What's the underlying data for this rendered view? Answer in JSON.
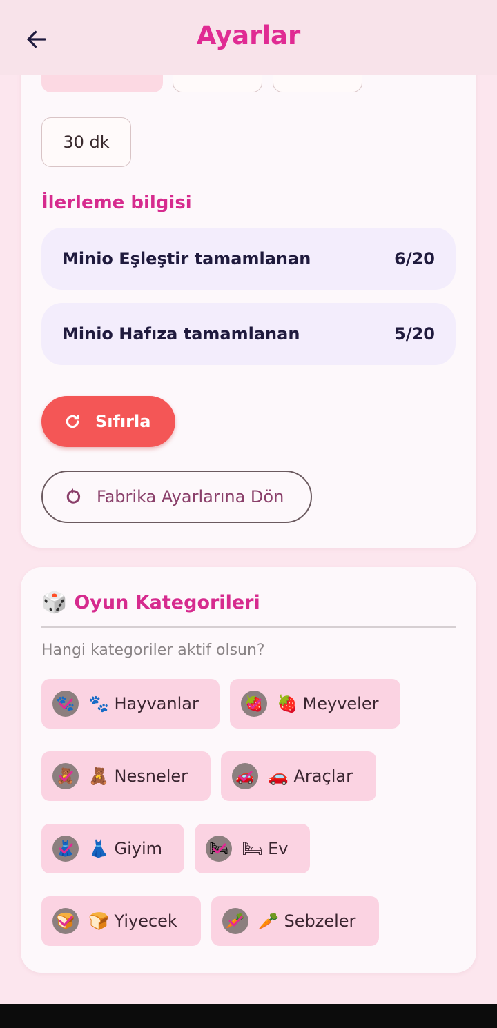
{
  "appbar": {
    "title": "Ayarlar"
  },
  "time_options": {
    "visible_option": "30 dk"
  },
  "progress": {
    "section_title": "İlerleme bilgisi",
    "rows": [
      {
        "label": "Minio Eşleştir tamamlanan",
        "value": "6/20"
      },
      {
        "label": "Minio Hafıza tamamlanan",
        "value": "5/20"
      }
    ]
  },
  "buttons": {
    "reset_label": "Sıfırla",
    "factory_label": "Fabrika Ayarlarına Dön"
  },
  "categories": {
    "title_emoji": "🎲",
    "title": "Oyun Kategorileri",
    "subtitle": "Hangi kategoriler aktif olsun?",
    "items": [
      {
        "emoji": "🐾",
        "name": "Hayvanlar",
        "label": "🐾 Hayvanlar",
        "selected": true
      },
      {
        "emoji": "🍓",
        "name": "Meyveler",
        "label": "🍓 Meyveler",
        "selected": true
      },
      {
        "emoji": "🧸",
        "name": "Nesneler",
        "label": "🧸 Nesneler",
        "selected": true
      },
      {
        "emoji": "🚗",
        "name": "Araçlar",
        "label": "🚗 Araçlar",
        "selected": true
      },
      {
        "emoji": "👗",
        "name": "Giyim",
        "label": "👗 Giyim",
        "selected": true
      },
      {
        "emoji": "🛏",
        "name": "Ev",
        "label": "🛏 Ev",
        "selected": true
      },
      {
        "emoji": "🍞",
        "name": "Yiyecek",
        "label": "🍞 Yiyecek",
        "selected": true
      },
      {
        "emoji": "🥕",
        "name": "Sebzeler",
        "label": "🥕 Sebzeler",
        "selected": true
      }
    ]
  },
  "colors": {
    "accent": "#e02b93",
    "reset": "#f45656",
    "chip_bg": "#fbd3e2",
    "progress_bg": "#f3edfc"
  }
}
